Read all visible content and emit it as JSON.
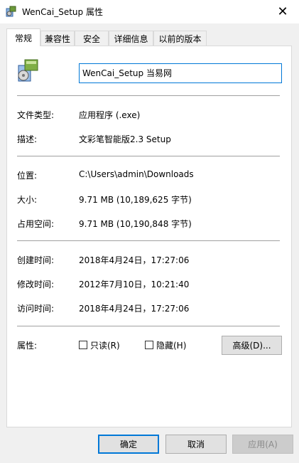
{
  "window": {
    "title": "WenCai_Setup 属性",
    "close_glyph": "✕"
  },
  "tabs": [
    {
      "label": "常规",
      "active": true
    },
    {
      "label": "兼容性"
    },
    {
      "label": "安全"
    },
    {
      "label": "详细信息"
    },
    {
      "label": "以前的版本"
    }
  ],
  "general": {
    "file_name": "WenCai_Setup 当易网",
    "file_type_label": "文件类型:",
    "file_type_value": "应用程序 (.exe)",
    "description_label": "描述:",
    "description_value": "文彩笔智能版2.3 Setup",
    "location_label": "位置:",
    "location_value": "C:\\Users\\admin\\Downloads",
    "size_label": "大小:",
    "size_value": "9.71 MB (10,189,625 字节)",
    "size_on_disk_label": "占用空间:",
    "size_on_disk_value": "9.71 MB (10,190,848 字节)",
    "created_label": "创建时间:",
    "created_value": "2018年4月24日，17:27:06",
    "modified_label": "修改时间:",
    "modified_value": "2012年7月10日，10:21:40",
    "accessed_label": "访问时间:",
    "accessed_value": "2018年4月24日，17:27:06",
    "attributes_label": "属性:",
    "readonly_label": "只读(R)",
    "readonly_checked": false,
    "hidden_label": "隐藏(H)",
    "hidden_checked": false,
    "advanced_button": "高级(D)..."
  },
  "footer": {
    "ok_button": "确定",
    "cancel_button": "取消",
    "apply_button": "应用(A)"
  },
  "colors": {
    "accent": "#0078d7",
    "separator": "#a0a0a0",
    "panel": "#ffffff",
    "window_bg": "#f0f0f0"
  }
}
